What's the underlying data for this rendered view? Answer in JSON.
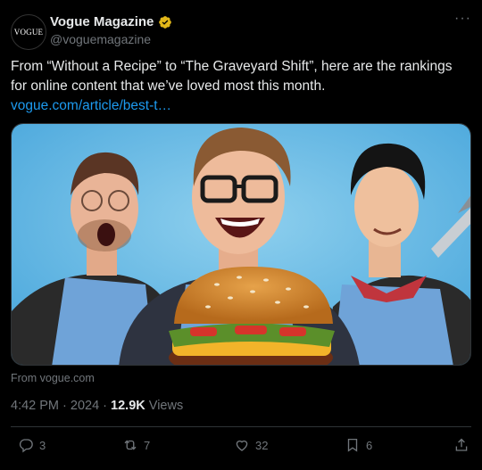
{
  "author": {
    "avatar_text": "VOGUE",
    "name": "Vogue Magazine",
    "handle": "@voguemagazine",
    "verified_color": "#e2b719"
  },
  "tweet": {
    "text": "From “Without a Recipe” to “The Graveyard Shift”, here are the rankings for online content that we’ve loved most this month. ",
    "link": "vogue.com/article/best-t…"
  },
  "media": {
    "source": "From vogue.com"
  },
  "meta": {
    "time": "4:42 PM",
    "separator": " · ",
    "date": "2024",
    "views_count": "12.9K",
    "views_label": " Views"
  },
  "actions": {
    "replies": "3",
    "reposts": "7",
    "likes": "32",
    "bookmarks": "6"
  },
  "colors": {
    "background": "#000000",
    "text": "#e7e9ea",
    "muted": "#71767b",
    "link": "#1d9bf0"
  }
}
